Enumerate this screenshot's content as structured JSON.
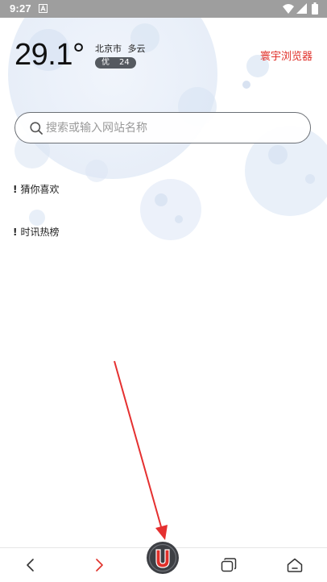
{
  "status_bar": {
    "time": "9:27",
    "icons": [
      "notification-a-icon",
      "wifi-icon",
      "signal-icon",
      "battery-icon"
    ],
    "background": "#9e9e9e"
  },
  "weather": {
    "temperature": "29.1°",
    "city": "北京市",
    "condition": "多云",
    "aqi_label": "优",
    "aqi_value": "24"
  },
  "brand": {
    "name": "寰宇浏览器",
    "color": "#e0302a"
  },
  "search": {
    "placeholder": "搜索或输入网站名称",
    "value": "",
    "icon": "search-icon"
  },
  "sections": {
    "guess": {
      "mark": "!",
      "label": "猜你喜欢"
    },
    "hot": {
      "mark": "!",
      "label": "时讯热榜"
    }
  },
  "bottom_nav": {
    "items": [
      {
        "name": "back",
        "icon": "chevron-left-icon",
        "color": "#333333"
      },
      {
        "name": "forward",
        "icon": "chevron-right-icon",
        "color": "#e0302a"
      },
      {
        "name": "home-logo",
        "icon": "u-logo-icon",
        "color": "#e0302a"
      },
      {
        "name": "tabs",
        "icon": "tabs-icon",
        "color": "#333333"
      },
      {
        "name": "home",
        "icon": "home-icon",
        "color": "#333333"
      }
    ]
  },
  "annotation": {
    "type": "arrow",
    "color": "#e53030"
  }
}
